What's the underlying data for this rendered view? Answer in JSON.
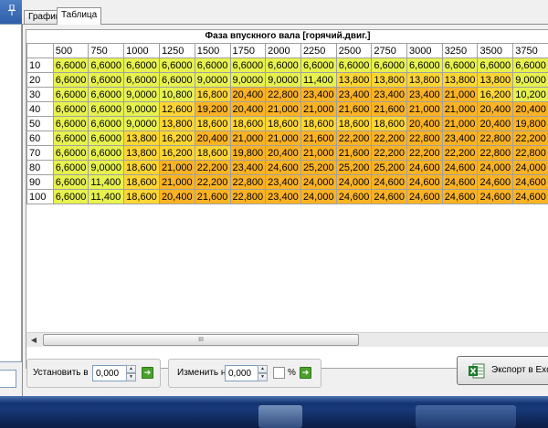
{
  "window": {
    "colors": {
      "window_bg": "#f0f0f0",
      "cell_green": "#e7f24e",
      "cell_yellow": "#ffd633",
      "cell_orange": "#fcb323",
      "taskbar": "#183a7a"
    }
  },
  "tabs": [
    {
      "label": "График",
      "active": false
    },
    {
      "label": "Таблица",
      "active": true
    }
  ],
  "grid": {
    "title": "Фаза впускного вала [горячий.двиг.]",
    "columns": [
      "500",
      "750",
      "1000",
      "1250",
      "1500",
      "1750",
      "2000",
      "2250",
      "2500",
      "2750",
      "3000",
      "3250",
      "3500",
      "3750"
    ],
    "rows": [
      {
        "label": "10",
        "cells": [
          "6,6000",
          "6,6000",
          "6,6000",
          "6,6000",
          "6,6000",
          "6,6000",
          "6,6000",
          "6,6000",
          "6,6000",
          "6,6000",
          "6,6000",
          "6,6000",
          "6,6000",
          "6,6000"
        ]
      },
      {
        "label": "20",
        "cells": [
          "6,6000",
          "6,6000",
          "6,6000",
          "6,6000",
          "9,0000",
          "9,0000",
          "9,0000",
          "11,400",
          "13,800",
          "13,800",
          "13,800",
          "13,800",
          "13,800",
          "9,0000"
        ]
      },
      {
        "label": "30",
        "cells": [
          "6,6000",
          "6,6000",
          "9,0000",
          "10,800",
          "16,800",
          "20,400",
          "22,800",
          "23,400",
          "23,400",
          "23,400",
          "23,400",
          "21,000",
          "16,200",
          "10,200"
        ]
      },
      {
        "label": "40",
        "cells": [
          "6,6000",
          "6,6000",
          "9,0000",
          "12,600",
          "19,200",
          "20,400",
          "21,000",
          "21,000",
          "21,600",
          "21,600",
          "21,000",
          "21,000",
          "20,400",
          "20,400"
        ]
      },
      {
        "label": "50",
        "cells": [
          "6,6000",
          "6,6000",
          "9,0000",
          "13,800",
          "18,600",
          "18,600",
          "18,600",
          "18,600",
          "18,600",
          "18,600",
          "20,400",
          "21,000",
          "20,400",
          "19,800"
        ]
      },
      {
        "label": "60",
        "cells": [
          "6,6000",
          "6,6000",
          "13,800",
          "16,200",
          "20,400",
          "21,000",
          "21,000",
          "21,600",
          "22,200",
          "22,200",
          "22,800",
          "23,400",
          "22,800",
          "22,200"
        ]
      },
      {
        "label": "70",
        "cells": [
          "6,6000",
          "6,6000",
          "13,800",
          "16,200",
          "18,600",
          "19,800",
          "20,400",
          "21,000",
          "21,600",
          "22,200",
          "22,200",
          "22,200",
          "22,800",
          "22,800"
        ]
      },
      {
        "label": "80",
        "cells": [
          "6,6000",
          "9,0000",
          "18,600",
          "21,000",
          "22,200",
          "23,400",
          "24,600",
          "25,200",
          "25,200",
          "25,200",
          "24,600",
          "24,600",
          "24,000",
          "24,000"
        ]
      },
      {
        "label": "90",
        "cells": [
          "6,6000",
          "11,400",
          "18,600",
          "21,000",
          "22,200",
          "22,800",
          "23,400",
          "24,000",
          "24,000",
          "24,600",
          "24,600",
          "24,600",
          "24,600",
          "24,600"
        ]
      },
      {
        "label": "100",
        "cells": [
          "6,6000",
          "11,400",
          "18,600",
          "20,400",
          "21,600",
          "22,800",
          "23,400",
          "24,000",
          "24,600",
          "24,600",
          "24,600",
          "24,600",
          "24,600",
          "24,600"
        ]
      }
    ]
  },
  "scrollbar": {
    "thumb_grip": "III"
  },
  "controls": {
    "set_to": {
      "label": "Установить в",
      "value": "0,000"
    },
    "change_by": {
      "label": "Изменить на",
      "value": "0,000",
      "percent_label": "%"
    },
    "export_label": "Экспорт в Exce"
  }
}
